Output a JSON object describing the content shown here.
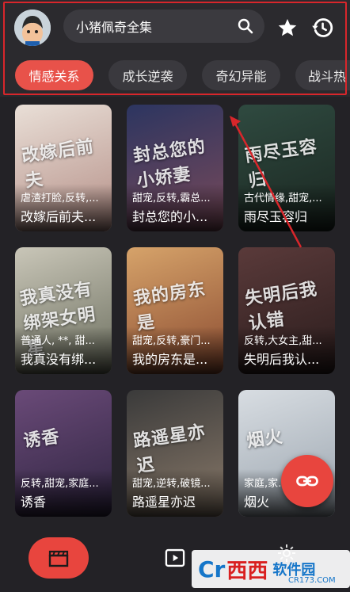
{
  "header": {
    "search_text": "小猪佩奇全集"
  },
  "tabs": [
    {
      "label": "情感关系",
      "active": true
    },
    {
      "label": "成长逆袭",
      "active": false
    },
    {
      "label": "奇幻异能",
      "active": false
    },
    {
      "label": "战斗热",
      "active": false
    }
  ],
  "dramas": [
    {
      "tags": "虐渣打脸,反转,...",
      "title": "改嫁后前夫...",
      "poster_text": "改嫁后前夫",
      "colors": [
        "#e9dfd7",
        "#b48e86"
      ]
    },
    {
      "tags": "甜宠,反转,霸总...",
      "title": "封总您的小...",
      "poster_text": "封总您的小娇妻",
      "colors": [
        "#2c3560",
        "#7a4a5a"
      ]
    },
    {
      "tags": "古代情缘,甜宠,...",
      "title": "雨尽玉容归",
      "poster_text": "雨尽玉容归",
      "colors": [
        "#2f4a40",
        "#1a2620"
      ]
    },
    {
      "tags": "普通人, **, 甜...",
      "title": "我真没有绑...",
      "poster_text": "我真没有绑架女明星",
      "colors": [
        "#c9c6b8",
        "#6b6e5e"
      ]
    },
    {
      "tags": "甜宠,反转,豪门...",
      "title": "我的房东是...",
      "poster_text": "我的房东是",
      "colors": [
        "#d6a36a",
        "#8a4a30"
      ]
    },
    {
      "tags": "反转,大女主,甜...",
      "title": "失明后我认...",
      "poster_text": "失明后我认错",
      "colors": [
        "#5a3a3a",
        "#2a1c1c"
      ]
    },
    {
      "tags": "反转,甜宠,家庭...",
      "title": "诱香",
      "poster_text": "诱香",
      "colors": [
        "#6a4a78",
        "#2e2440"
      ]
    },
    {
      "tags": "甜宠,逆转,破镜...",
      "title": "路遥星亦迟",
      "poster_text": "路遥星亦迟",
      "colors": [
        "#3a3a3a",
        "#8a7a6a"
      ]
    },
    {
      "tags": "家庭,家...",
      "title": "烟火",
      "poster_text": "烟火",
      "colors": [
        "#d8dde2",
        "#9aa4ae"
      ]
    }
  ],
  "watermark": {
    "logo": "Cr",
    "brand": "西西",
    "text": "软件园",
    "sub": "CR173.COM"
  },
  "colors": {
    "accent": "#e8453e",
    "background": "#232226",
    "annotation": "#d8262b"
  }
}
